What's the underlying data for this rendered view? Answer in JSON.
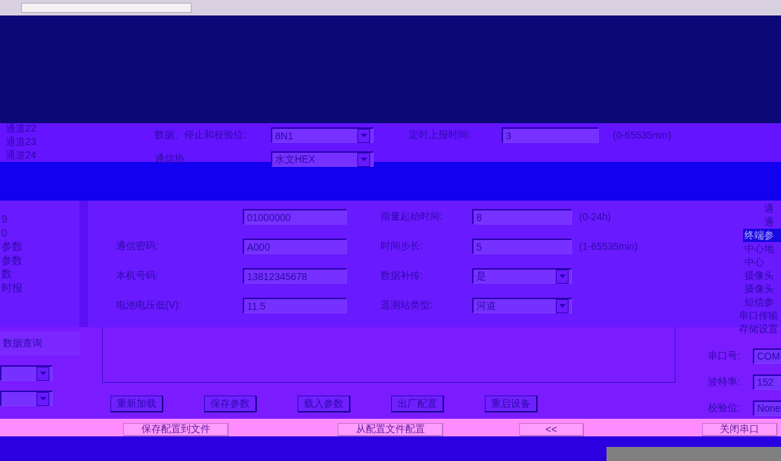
{
  "channel_list": [
    "通道22",
    "通道23",
    "通道24"
  ],
  "serial_settings": [
    {
      "label": "数据、停止和校验位:",
      "kind": "combo",
      "value": "8N1"
    },
    {
      "label": "定时上报时间:",
      "kind": "text",
      "value": "3",
      "hint": "(0-65535min)"
    },
    {
      "label": "通信协",
      "kind": "combo",
      "value": "水文HEX"
    }
  ],
  "param_list": [
    "9",
    "0",
    "参数",
    "参数",
    "数",
    "时报"
  ],
  "params": [
    {
      "kind": "text",
      "value": "01000000"
    },
    {
      "label": "雨量起始时间:",
      "kind": "text",
      "value": "8",
      "hint": "(0-24h)"
    },
    {
      "label": "通信密码:",
      "kind": "text",
      "value": "A000"
    },
    {
      "label": "时间步长:",
      "kind": "text",
      "value": "5",
      "hint": "(1-65535min)"
    },
    {
      "label": "本机号码:",
      "kind": "text",
      "value": "13812345678"
    },
    {
      "label": "数据补传:",
      "kind": "combo",
      "value": "是"
    },
    {
      "label": "电池电压低(V):",
      "kind": "text",
      "value": "11.5"
    },
    {
      "label": "遥测站类型:",
      "kind": "combo",
      "value": "河道"
    }
  ],
  "tree": [
    {
      "label": "通",
      "selected": false
    },
    {
      "label": "通",
      "selected": false
    },
    {
      "label": "终端参",
      "selected": true
    },
    {
      "label": "中心地",
      "selected": false
    },
    {
      "label": "中心",
      "selected": false
    },
    {
      "label": "摄像头",
      "selected": false
    },
    {
      "label": "摄像头",
      "selected": false
    },
    {
      "label": "短信参",
      "selected": false
    },
    {
      "label": "串口传输",
      "selected": false
    },
    {
      "label": "存储设置",
      "selected": false
    }
  ],
  "query_list": [
    "数据查询"
  ],
  "actions": [
    "重新加载",
    "保存参数",
    "载入参数",
    "出厂配置",
    "重启设备"
  ],
  "port": [
    {
      "label": "串口号:",
      "value": "COM"
    },
    {
      "label": "波特率:",
      "value": "152"
    },
    {
      "label": "校验位:",
      "value": "None"
    }
  ],
  "footer_buttons": [
    "保存配置到文件",
    "从配置文件配置",
    "<<",
    "关闭串口"
  ]
}
